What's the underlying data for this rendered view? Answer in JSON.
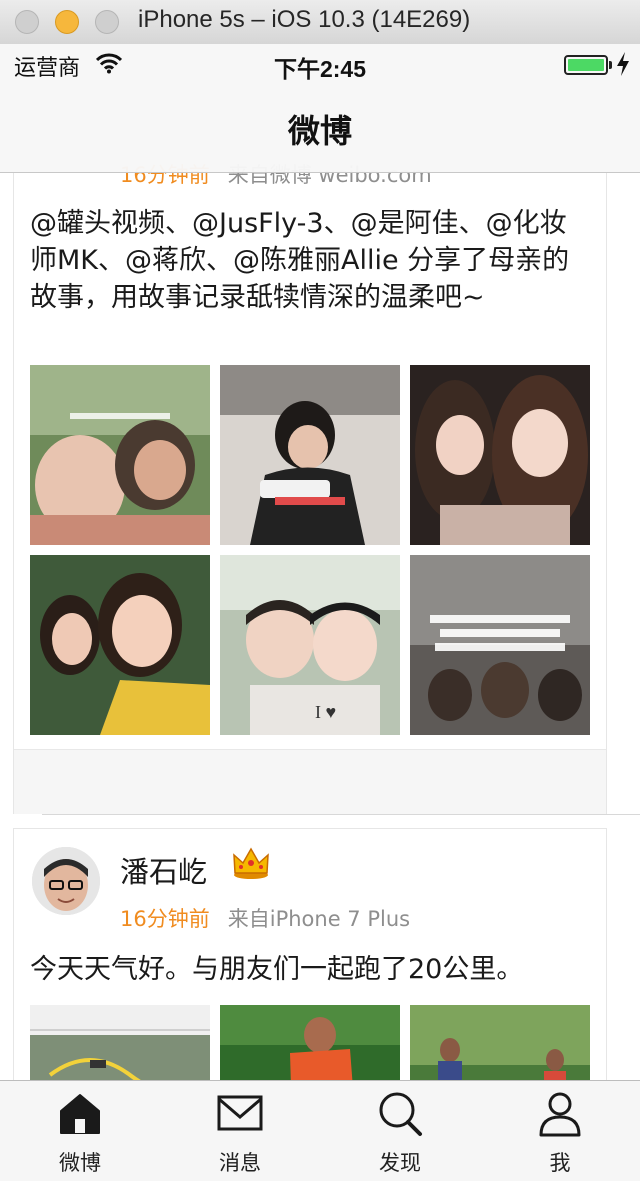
{
  "window": {
    "title": "iPhone 5s – iOS 10.3 (14E269)"
  },
  "status_bar": {
    "carrier": "运营商",
    "time": "下午2:45",
    "battery_level": 1.0
  },
  "nav": {
    "title": "微博"
  },
  "posts": [
    {
      "time": "16分钟前",
      "source": "来自微博 weibo.com",
      "text": "@罐头视频、@JusFly-3、@是阿佳、@化妆师MK、@蒋欣、@陈雅丽Allie 分享了母亲的故事，用故事记录舐犊情深的温柔吧~"
    },
    {
      "author": "潘石屹",
      "time": "16分钟前",
      "source": "来自iPhone 7 Plus",
      "text": "今天天气好。与朋友们一起跑了20公里。"
    }
  ],
  "tabs": [
    {
      "label": "微博",
      "icon": "home-icon",
      "active": true
    },
    {
      "label": "消息",
      "icon": "envelope-icon",
      "active": false
    },
    {
      "label": "发现",
      "icon": "search-icon",
      "active": false
    },
    {
      "label": "我",
      "icon": "person-icon",
      "active": false
    }
  ],
  "colors": {
    "accent_time": "#f08c20",
    "source_gray": "#8e8e8e",
    "battery_green": "#4cd964"
  }
}
